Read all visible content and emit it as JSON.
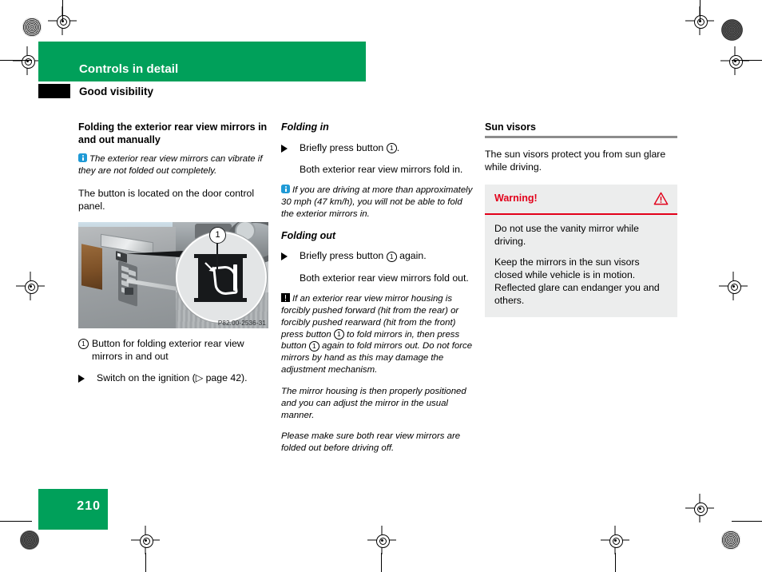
{
  "header": {
    "chapter": "Controls in detail",
    "section": "Good visibility"
  },
  "footer": {
    "page_number": "210"
  },
  "colors": {
    "brand_green": "#00a05a",
    "warning_red": "#e2001a",
    "info_blue": "#1f9ad6",
    "rule_gray": "#8c8c8c",
    "warnbox_bg": "#eceded"
  },
  "column1": {
    "heading": "Folding the exterior rear view mirrors in and out manually",
    "info_note": "The exterior rear view mirrors can vibrate if they are not folded out completely.",
    "body": "The button is located on the door control panel.",
    "figure": {
      "code": "P82.00-2536-31",
      "callout_number": "1",
      "alt": "Driver door control panel with magnified view of the mirror folding button"
    },
    "legend": {
      "number": "1",
      "text": "Button for folding exterior rear view mirrors in and out"
    },
    "step": "Switch on the ignition (▷ page 42)."
  },
  "column2": {
    "folding_in": {
      "heading": "Folding in",
      "step_prefix": "Briefly press button",
      "step_number": "1",
      "step_suffix": ".",
      "result": "Both exterior rear view mirrors fold in.",
      "info_note": "If you are driving at more than approximately 30 mph (47 km/h), you will not be able to fold the exterior mirrors in."
    },
    "folding_out": {
      "heading": "Folding out",
      "step_prefix": "Briefly press button",
      "step_number": "1",
      "step_suffix": "again.",
      "result": "Both exterior rear view mirrors fold out.",
      "caution_note_part1": "If an exterior rear view mirror housing is forcibly pushed forward (hit from the rear) or forcibly pushed rearward (hit from the front) press button",
      "caution_note_num1": "1",
      "caution_note_part2": "to fold mirrors in, then press button",
      "caution_note_num2": "1",
      "caution_note_part3": "again to fold mirrors out. Do not force mirrors by hand as this may damage the adjustment mechanism.",
      "note2": "The mirror housing is then properly positioned and you can adjust the mirror in the usual manner.",
      "note3": "Please make sure both rear view mirrors are folded out before driving off."
    }
  },
  "column3": {
    "heading": "Sun visors",
    "body": "The sun visors protect you from sun glare while driving.",
    "warning": {
      "title": "Warning!",
      "icon": "warning-triangle-icon",
      "paragraphs": [
        "Do not use the vanity mirror while driving.",
        "Keep the mirrors in the sun visors closed while vehicle is in motion. Reflected glare can endanger you and others."
      ]
    }
  }
}
